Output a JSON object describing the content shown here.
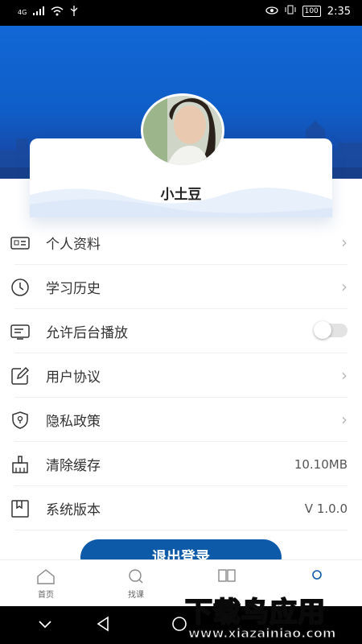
{
  "status_bar": {
    "network": "4G",
    "time": "2:35",
    "battery": "100"
  },
  "profile": {
    "username": "小土豆"
  },
  "menu": [
    {
      "label": "个人资料",
      "type": "chevron"
    },
    {
      "label": "学习历史",
      "type": "chevron"
    },
    {
      "label": "允许后台播放",
      "type": "toggle",
      "on": false
    },
    {
      "label": "用户协议",
      "type": "chevron"
    },
    {
      "label": "隐私政策",
      "type": "chevron"
    },
    {
      "label": "清除缓存",
      "type": "value",
      "value": "10.10MB"
    },
    {
      "label": "系统版本",
      "type": "value",
      "value": "V 1.0.0"
    }
  ],
  "logout_label": "退出登录",
  "tabs": [
    {
      "label": "首页",
      "icon": "home-icon"
    },
    {
      "label": "找课",
      "icon": "search-icon"
    },
    {
      "label": "",
      "icon": "grid-icon"
    },
    {
      "label": "",
      "icon": "user-icon"
    }
  ],
  "watermark": {
    "brand": "下载鸟应用",
    "url": "www.xiazainiao.com"
  },
  "colors": {
    "banner_blue": "#1267d6",
    "logout_button": "#0c5aa8",
    "watermark_green": "#4fd16a"
  }
}
